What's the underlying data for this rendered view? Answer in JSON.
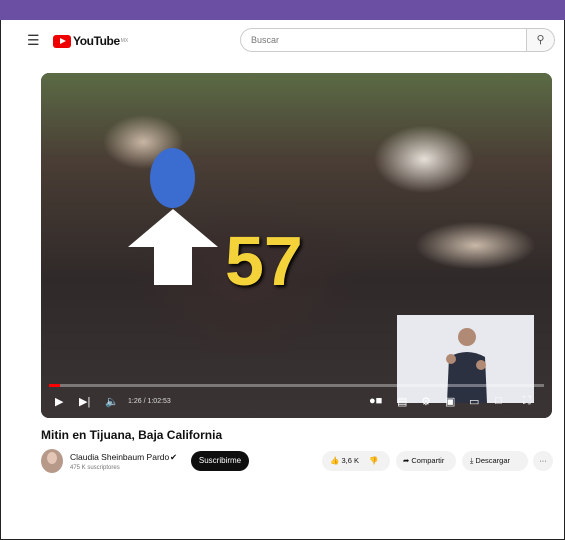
{
  "header": {
    "brand": "YouTube",
    "brand_region": "MX",
    "search_placeholder": "Buscar"
  },
  "video": {
    "overlay_number": "57",
    "current_time": "1:26",
    "duration": "1:02:53",
    "time_display": "1:26 / 1:02:53",
    "progress_fraction": 0.023
  },
  "title": "Mitin en Tijuana, Baja California",
  "channel": {
    "name": "Claudia Sheinbaum Pardo",
    "subscribers": "475 K suscriptores"
  },
  "actions": {
    "subscribe": "Suscribirme",
    "likes": "3,6 K",
    "share": "Compartir",
    "download": "Descargar",
    "more": "···"
  },
  "colors": {
    "brand_red": "#ff0000",
    "overlay_number": "#f3d23a",
    "dot": "#3b6ccf",
    "top_bar": "#6a4fa3"
  }
}
